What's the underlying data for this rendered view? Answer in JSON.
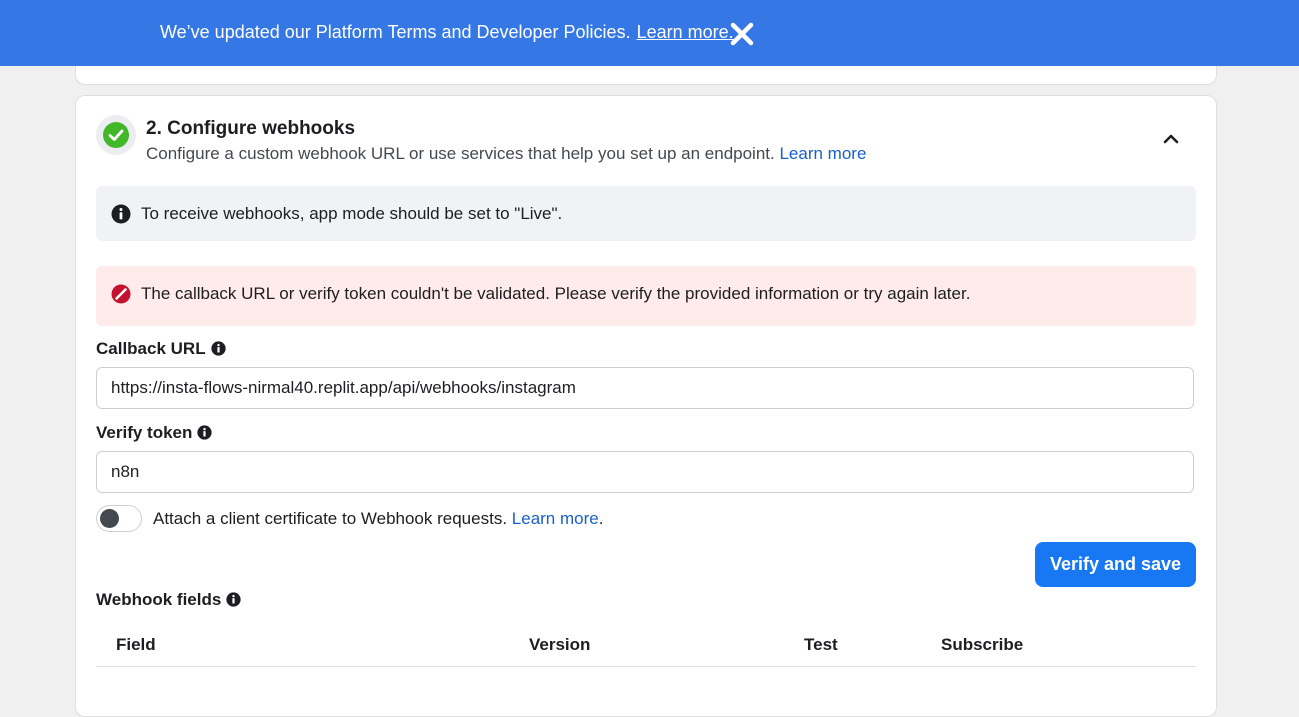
{
  "banner": {
    "message": "We’ve updated our Platform Terms and Developer Policies.",
    "link": "Learn more.",
    "background": "#3578e5"
  },
  "section": {
    "title": "2. Configure webhooks",
    "description": "Configure a custom webhook URL or use services that help you set up an endpoint.",
    "description_link": "Learn more",
    "status_icon": "check-circle-icon",
    "status_color": "#42b72a"
  },
  "info_notice": {
    "text": "To receive webhooks, app mode should be set to \"Live\"."
  },
  "error_notice": {
    "text": "The callback URL or verify token couldn't be validated. Please verify the provided information or try again later.",
    "color": "#c4122f"
  },
  "callback_url": {
    "label": "Callback URL",
    "value": "https://insta-flows-nirmal40.replit.app/api/webhooks/instagram"
  },
  "verify_token": {
    "label": "Verify token",
    "value": "n8n"
  },
  "client_certificate": {
    "label": "Attach a client certificate to Webhook requests.",
    "link": "Learn more",
    "suffix": ".",
    "enabled": false
  },
  "actions": {
    "verify_and_save": "Verify and save",
    "primary_color": "#1877f2"
  },
  "webhook_fields": {
    "label": "Webhook fields",
    "columns": [
      "Field",
      "Version",
      "Test",
      "Subscribe"
    ]
  }
}
